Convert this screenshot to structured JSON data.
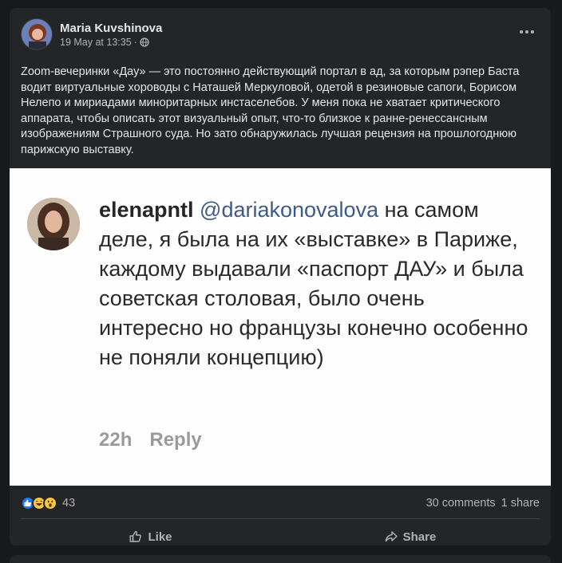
{
  "post": {
    "author": "Maria Kuvshinova",
    "timestamp": "19 May at 13:35",
    "separator": "·",
    "privacy_icon": "globe-icon",
    "more_icon": "more-options-icon",
    "text": "Zoom-вечеринки «Дау» — это постоянно действующий портал в ад, за которым рэпер Баста водит виртуальные хороводы с Наташей Меркуловой, одетой в резиновые сапоги, Борисом Нелепо и мириадами миноритарных инстаселебов. У меня пока не хватает критического аппарата, чтобы описать этот визуальный опыт, что-то близкое к ранне-ренессансным изображениям Страшного суда. Но зато обнаружилась лучшая рецензия на прошлогоднюю парижскую выставку."
  },
  "image": {
    "comment_user": "elenapntl",
    "comment_mention": "@dariakonovalova",
    "comment_text": " на самом деле, я была на их «выставке» в Париже, каждому выдавали «паспорт ДАУ» и была советская столовая, было очень интересно но французы конечно особенно не поняли концепцию)",
    "comment_time": "22h",
    "comment_reply": "Reply"
  },
  "stats": {
    "reactions_count": "43",
    "comments": "30 comments",
    "shares": "1 share"
  },
  "actions": {
    "like_label": "Like",
    "share_label": "Share"
  }
}
